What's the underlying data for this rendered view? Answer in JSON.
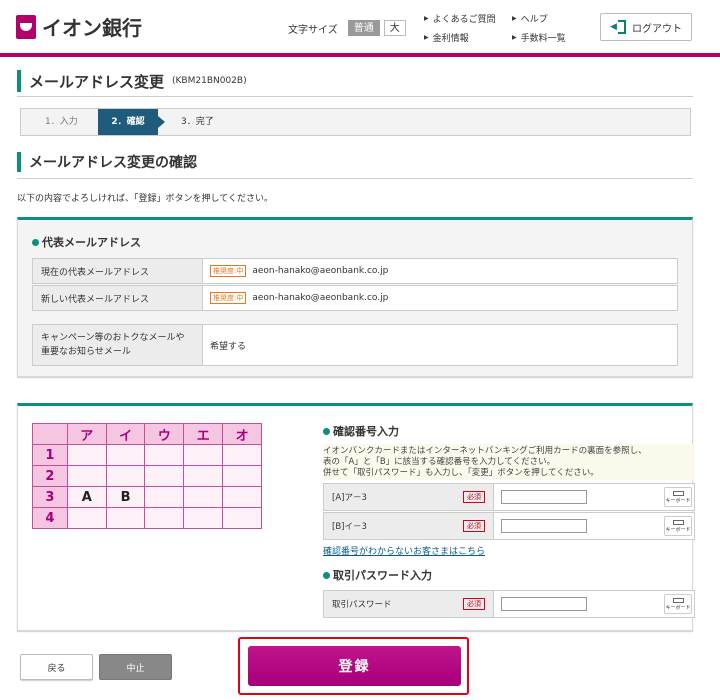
{
  "header": {
    "logo_text": "イオン銀行",
    "font_size_label": "文字サイズ",
    "font_size_normal": "普通",
    "font_size_large": "大",
    "links": [
      "よくあるご質問",
      "ヘルプ",
      "金利情報",
      "手数料一覧"
    ],
    "logout_label": "ログアウト"
  },
  "page": {
    "title": "メールアドレス変更",
    "code": "(KBM21BN002B)",
    "steps": [
      "1．入力",
      "2．確認",
      "3．完了"
    ],
    "sub_title": "メールアドレス変更の確認",
    "instruction": "以下の内容でよろしければ、「登録」ボタンを押してください。"
  },
  "email_section": {
    "heading": "代表メールアドレス",
    "rows": [
      {
        "label": "現在の代表メールアドレス",
        "badge": "推奨度:中",
        "value": "aeon-hanako@aeonbank.co.jp"
      },
      {
        "label": "新しい代表メールアドレス",
        "badge": "推奨度:中",
        "value": "aeon-hanako@aeonbank.co.jp"
      }
    ],
    "campaign_label_line1": "キャンペーン等のおトクなメールや",
    "campaign_label_line2": "重要なお知らせメール",
    "campaign_value": "希望する"
  },
  "security": {
    "grid_cols": [
      "ア",
      "イ",
      "ウ",
      "エ",
      "オ"
    ],
    "grid_rows": [
      "1",
      "2",
      "3",
      "4"
    ],
    "cell_3_a": "A",
    "cell_3_i": "B",
    "confirm_heading": "確認番号入力",
    "confirm_desc_1": "イオンバンクカードまたはインターネットバンキングご利用カードの裏面を参照し、",
    "confirm_desc_2": "表の「A」と「B」に該当する確認番号を入力してください。",
    "confirm_desc_3": "併せて「取引パスワード」も入力し、「変更」ボタンを押してください。",
    "code_a_label": "[A]ア－3",
    "code_b_label": "[B]イ－3",
    "required": "必須",
    "keyboard_label": "キーボード",
    "help_link": "確認番号がわからないお客さまはこちら",
    "password_heading": "取引パスワード入力",
    "password_label": "取引パスワード"
  },
  "buttons": {
    "back": "戻る",
    "stop": "中止",
    "register": "登録"
  }
}
